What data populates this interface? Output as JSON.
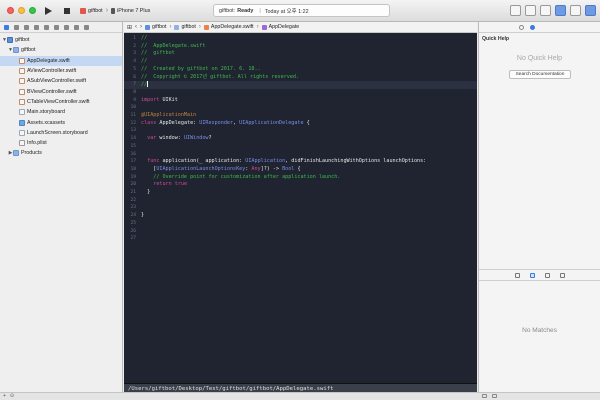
{
  "toolbar": {
    "scheme_target": "giftbot",
    "device": "iPhone 7 Plus",
    "status_project": "giftbot:",
    "status_state": "Ready",
    "status_time": "Today at 오후 1:22"
  },
  "navigator": {
    "items": [
      {
        "label": "giftbot",
        "kind": "proj",
        "indent": 0,
        "tri": "▼"
      },
      {
        "label": "giftbot",
        "kind": "folder",
        "indent": 1,
        "tri": "▼"
      },
      {
        "label": "AppDelegate.swift",
        "kind": "swift",
        "indent": 2,
        "tri": "",
        "selected": true
      },
      {
        "label": "AViewController.swift",
        "kind": "swift",
        "indent": 2,
        "tri": ""
      },
      {
        "label": "ASubViewController.swift",
        "kind": "swift",
        "indent": 2,
        "tri": ""
      },
      {
        "label": "BViewController.swift",
        "kind": "swift",
        "indent": 2,
        "tri": ""
      },
      {
        "label": "CTableViewController.swift",
        "kind": "swift",
        "indent": 2,
        "tri": ""
      },
      {
        "label": "Main.storyboard",
        "kind": "sb",
        "indent": 2,
        "tri": ""
      },
      {
        "label": "Assets.xcassets",
        "kind": "assets",
        "indent": 2,
        "tri": ""
      },
      {
        "label": "LaunchScreen.storyboard",
        "kind": "sb",
        "indent": 2,
        "tri": ""
      },
      {
        "label": "Info.plist",
        "kind": "plist",
        "indent": 2,
        "tri": ""
      },
      {
        "label": "Products",
        "kind": "folder",
        "indent": 1,
        "tri": "▶"
      }
    ]
  },
  "jumpbar": {
    "crumbs": [
      "giftbot",
      "giftbot",
      "AppDelegate.swift",
      "AppDelegate"
    ]
  },
  "editor": {
    "current_line": 6,
    "lines": [
      [
        [
          "//",
          "com"
        ]
      ],
      [
        [
          "//  AppDelegate.swift",
          "com"
        ]
      ],
      [
        [
          "//  giftbot",
          "com"
        ]
      ],
      [
        [
          "//",
          "com"
        ]
      ],
      [
        [
          "//  Created by giftbot on 2017. 6. 18..",
          "com"
        ]
      ],
      [
        [
          "//  Copyright © 2017년 giftbot. All rights reserved.",
          "com"
        ]
      ],
      [
        [
          "//",
          "com"
        ]
      ],
      [],
      [
        [
          "import",
          "kw"
        ],
        [
          " UIKit",
          "plain"
        ]
      ],
      [],
      [
        [
          "@UIApplicationMain",
          "attr"
        ]
      ],
      [
        [
          "class",
          "kw"
        ],
        [
          " AppDelegate: ",
          "plain"
        ],
        [
          "UIResponder",
          "type"
        ],
        [
          ", ",
          "plain"
        ],
        [
          "UIApplicationDelegate",
          "type"
        ],
        [
          " {",
          "plain"
        ]
      ],
      [],
      [
        [
          "  ",
          "plain"
        ],
        [
          "var",
          "kw"
        ],
        [
          " window: ",
          "plain"
        ],
        [
          "UIWindow",
          "type"
        ],
        [
          "?",
          "plain"
        ]
      ],
      [],
      [],
      [
        [
          "  ",
          "plain"
        ],
        [
          "func",
          "kw"
        ],
        [
          " application(_ application: ",
          "plain"
        ],
        [
          "UIApplication",
          "type"
        ],
        [
          ", didFinishLaunchingWithOptions launchOptions:",
          "plain"
        ]
      ],
      [
        [
          "    [",
          "plain"
        ],
        [
          "UIApplicationLaunchOptionsKey",
          "type"
        ],
        [
          ": ",
          "plain"
        ],
        [
          "Any",
          "kw"
        ],
        [
          "]?) -> ",
          "plain"
        ],
        [
          "Bool",
          "type"
        ],
        [
          " {",
          "plain"
        ]
      ],
      [
        [
          "    // Override point for customization after application launch.",
          "com"
        ]
      ],
      [
        [
          "    ",
          "plain"
        ],
        [
          "return",
          "kw"
        ],
        [
          " ",
          "plain"
        ],
        [
          "true",
          "kw"
        ]
      ],
      [
        [
          "  }",
          "plain"
        ]
      ],
      [],
      [],
      [
        [
          "}",
          "plain"
        ]
      ],
      [],
      [],
      []
    ]
  },
  "pathbar": {
    "path": "/Users/giftbot/Desktop/Test/giftbot/giftbot/AppDelegate.swift"
  },
  "inspector": {
    "title": "Quick Help",
    "empty_text": "No Quick Help",
    "search_button": "Search Documentation",
    "library_empty": "No Matches"
  },
  "colors": {
    "editor_bg": "#1f2430",
    "comment": "#3fb950",
    "keyword": "#d04a9c",
    "type": "#7c8de8",
    "selection": "#c4d8f3"
  }
}
